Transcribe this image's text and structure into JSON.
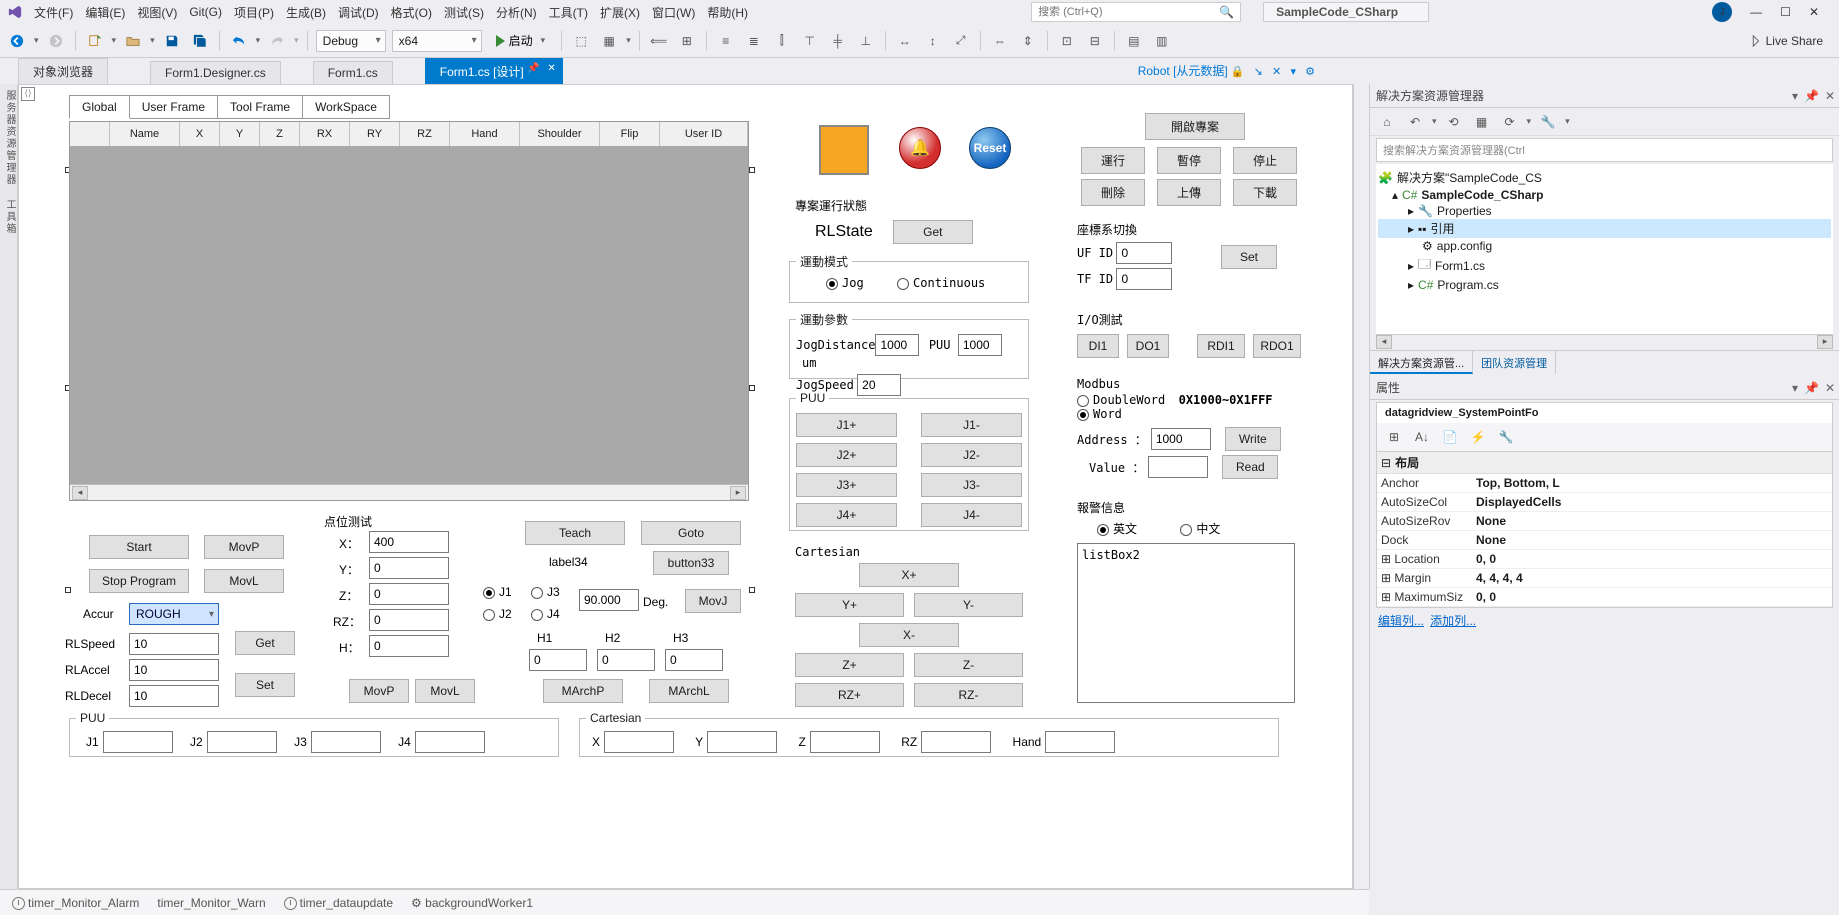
{
  "menu": {
    "items": [
      "文件(F)",
      "编辑(E)",
      "视图(V)",
      "Git(G)",
      "项目(P)",
      "生成(B)",
      "调试(D)",
      "格式(O)",
      "测试(S)",
      "分析(N)",
      "工具(T)",
      "扩展(X)",
      "窗口(W)",
      "帮助(H)"
    ],
    "search_ph": "搜索 (Ctrl+Q)",
    "project": "SampleCode_CSharp"
  },
  "toolbar": {
    "config": "Debug",
    "platform": "x64",
    "start": "启动",
    "liveshare": "Live Share"
  },
  "tabs": {
    "t0": "对象浏览器",
    "t1": "Form1.Designer.cs",
    "t2": "Form1.cs",
    "t3": "Form1.cs [设计]",
    "hint": "Robot [从元数据]"
  },
  "leftrail": "服务器资源管理器  工具箱",
  "formtabs": [
    "Global",
    "User Frame",
    "Tool Frame",
    "WorkSpace"
  ],
  "gridcols": [
    "",
    "Name",
    "X",
    "Y",
    "Z",
    "RX",
    "RY",
    "RZ",
    "Hand",
    "Shoulder",
    "Flip",
    "User ID"
  ],
  "buttons": {
    "start": "Start",
    "stop": "Stop Program",
    "movp": "MovP",
    "movl": "MovL",
    "get": "Get",
    "set": "Set",
    "teach": "Teach",
    "goto": "Goto",
    "label34": "label34",
    "button33": "button33",
    "movj": "MovJ",
    "marchp": "MArchP",
    "marchl": "MArchL",
    "open_proj": "開啟專案",
    "run": "運行",
    "pause": "暫停",
    "stopp": "停止",
    "delete": "刪除",
    "upload": "上傳",
    "download": "下載",
    "setcoord": "Set",
    "di1": "DI1",
    "do1": "DO1",
    "rdi1": "RDI1",
    "rdo1": "RDO1",
    "write": "Write",
    "read": "Read"
  },
  "labels": {
    "ptest": "点位测试",
    "accur": "Accur",
    "rlspeed": "RLSpeed",
    "rlaccel": "RLAccel",
    "rldecel": "RLDecel",
    "puu": "PUU",
    "cartesian": "Cartesian",
    "x": "X：",
    "y": "Y：",
    "z": "Z：",
    "rz": "RZ：",
    "h": "H：",
    "j1r": "J1",
    "j2r": "J2",
    "j3r": "J3",
    "j4r": "J4",
    "deg": "Deg.",
    "h1": "H1",
    "h2": "H2",
    "h3": "H3",
    "j1": "J1",
    "j2": "J2",
    "j3": "J3",
    "j4": "J4",
    "cx": "X",
    "cy": "Y",
    "cz": "Z",
    "crz": "RZ",
    "chand": "Hand",
    "projstate": "專案運行狀態",
    "rlstate": "RLState",
    "getbtn": "Get",
    "motionmode": "運動模式",
    "jog": "Jog",
    "cont": "Continuous",
    "motionparam": "運動參數",
    "jogdist": "JogDistance",
    "puu_u": "PUU",
    "um": "um",
    "jogspeed": "JogSpeed",
    "puusection": "PUU",
    "cart": "Cartesian",
    "coord": "座標系切換",
    "ufid": "UF ID",
    "tfid": "TF ID",
    "iotest": "I/O測試",
    "modbus": "Modbus",
    "dword": "DoubleWord",
    "word": "Word",
    "range": "0X1000~0X1FFF",
    "address": "Address ：",
    "value": "Value ：",
    "alarminfo": "報警信息",
    "en": "英文",
    "cn": "中文",
    "listbox": "listBox2",
    "reset": "Reset"
  },
  "jog": {
    "j1p": "J1+",
    "j1m": "J1-",
    "j2p": "J2+",
    "j2m": "J2-",
    "j3p": "J3+",
    "j3m": "J3-",
    "j4p": "J4+",
    "j4m": "J4-",
    "xp": "X+",
    "xm": "X-",
    "yp": "Y+",
    "ym": "Y-",
    "zp": "Z+",
    "zm": "Z-",
    "rzp": "RZ+",
    "rzm": "RZ-"
  },
  "values": {
    "accur": "ROUGH",
    "rlspeed": "10",
    "rlaccel": "10",
    "rldecel": "10",
    "x": "400",
    "y": "0",
    "z": "0",
    "rz": "0",
    "h": "0",
    "angle": "90.000",
    "h1": "0",
    "h2": "0",
    "h3": "0",
    "jogdist": "1000",
    "jogum": "1000",
    "jogspeed": "20",
    "ufid": "0",
    "tfid": "0",
    "address": "1000",
    "value": ""
  },
  "solution": {
    "title": "解决方案资源管理器",
    "search_ph": "搜索解决方案资源管理器(Ctrl",
    "root": "解决方案\"SampleCode_CS",
    "proj": "SampleCode_CSharp",
    "properties": "Properties",
    "refs": "引用",
    "appconfig": "app.config",
    "form1": "Form1.cs",
    "program": "Program.cs",
    "tab1": "解决方案资源管...",
    "tab2": "团队资源管理"
  },
  "props": {
    "title": "属性",
    "obj": "datagridview_SystemPointFo",
    "cat": "布局",
    "anchor_k": "Anchor",
    "anchor_v": "Top, Bottom, L",
    "autocol_k": "AutoSizeCol",
    "autocol_v": "DisplayedCells",
    "autorow_k": "AutoSizeRov",
    "autorow_v": "None",
    "dock_k": "Dock",
    "dock_v": "None",
    "loc_k": "Location",
    "loc_v": "0, 0",
    "margin_k": "Margin",
    "margin_v": "4, 4, 4, 4",
    "max_k": "MaximumSiz",
    "max_v": "0, 0",
    "link1": "编辑列...",
    "link2": "添加列..."
  },
  "tray": {
    "t1": "timer_Monitor_Alarm",
    "t2": "timer_Monitor_Warn",
    "t3": "timer_dataupdate",
    "t4": "backgroundWorker1"
  }
}
